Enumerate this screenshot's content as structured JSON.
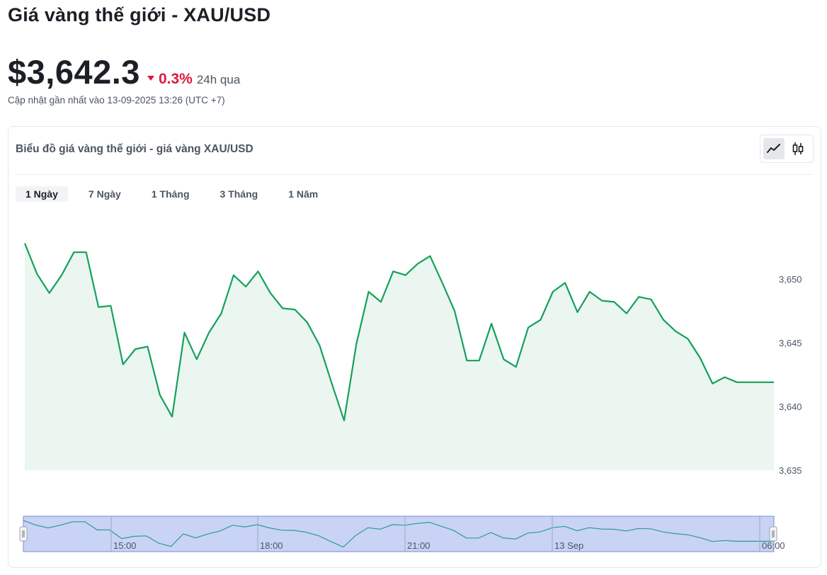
{
  "header": {
    "title": "Giá vàng thế giới - XAU/USD",
    "price": "$3,642.3",
    "change_pct": "0.3%",
    "change_period": "24h qua",
    "updated": "Cập nhật gần nhất vào 13-09-2025 13:26 (UTC +7)"
  },
  "card": {
    "title": "Biểu đồ giá vàng thế giới - giá vàng XAU/USD",
    "chart_types": [
      {
        "name": "line-chart-icon",
        "active": true
      },
      {
        "name": "candlestick-icon",
        "active": false
      }
    ],
    "ranges": [
      "1 Ngày",
      "7 Ngày",
      "1 Tháng",
      "3 Tháng",
      "1 Năm"
    ],
    "active_range": "1 Ngày"
  },
  "colors": {
    "line": "#16a05b",
    "area": "#eaf6ef",
    "down": "#e0183c",
    "navigator_fill": "#c9d3f5",
    "navigator_border": "#7b8ec7",
    "navigator_line": "#2a9d8f"
  },
  "chart_data": {
    "type": "area",
    "title": "",
    "xlabel": "",
    "ylabel": "",
    "ylim": [
      3635,
      3655
    ],
    "yticks": [
      3635,
      3640,
      3645,
      3650
    ],
    "ytick_labels": [
      "3,635",
      "3,640",
      "3,645",
      "3,650"
    ],
    "navigator_ticks": [
      "15:00",
      "18:00",
      "21:00",
      "13 Sep",
      "06:00"
    ],
    "series": [
      {
        "values": [
          3652.8,
          3650.4,
          3648.9,
          3650.3,
          3652.1,
          3652.1,
          3647.8,
          3647.9,
          3643.3,
          3644.5,
          3644.7,
          3640.9,
          3639.2,
          3645.8,
          3643.7,
          3645.8,
          3647.3,
          3650.3,
          3649.4,
          3650.6,
          3648.9,
          3647.7,
          3647.6,
          3646.6,
          3644.8,
          3641.8,
          3638.9,
          3644.9,
          3649.0,
          3648.2,
          3650.6,
          3650.3,
          3651.2,
          3651.8,
          3649.7,
          3647.5,
          3643.6,
          3643.6,
          3646.5,
          3643.7,
          3643.1,
          3646.2,
          3646.8,
          3649.0,
          3649.7,
          3647.4,
          3649.0,
          3648.3,
          3648.2,
          3647.3,
          3648.6,
          3648.4,
          3646.8,
          3645.9,
          3645.3,
          3643.8,
          3641.8,
          3642.3,
          3641.9,
          3641.9,
          3641.9,
          3641.9
        ]
      }
    ]
  }
}
